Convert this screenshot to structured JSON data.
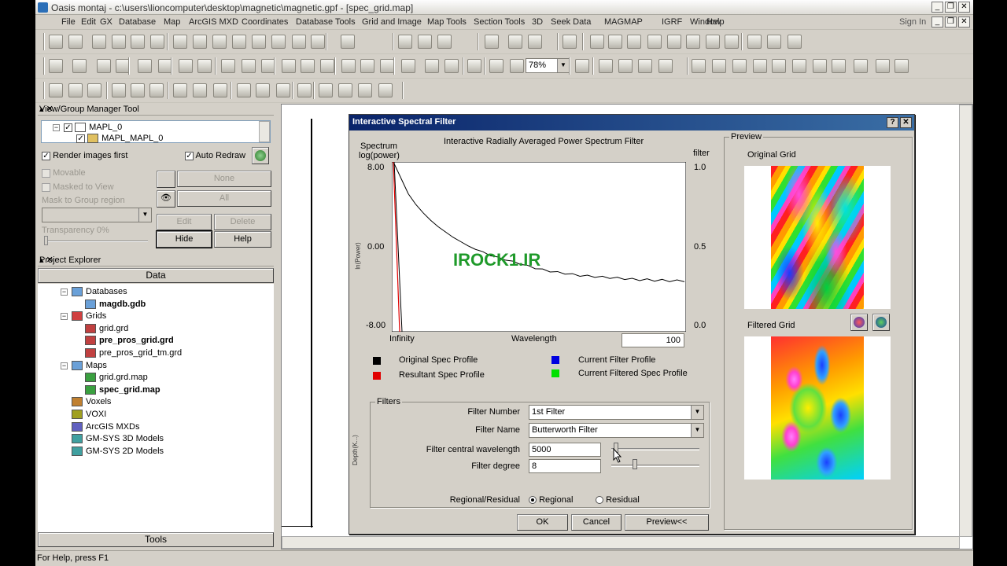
{
  "window": {
    "title": "Oasis montaj - c:\\users\\lioncomputer\\desktop\\magnetic\\magnetic.gpf - [spec_grid.map]"
  },
  "menu": [
    "File",
    "Edit",
    "GX",
    "Database",
    "Map",
    "ArcGIS MXD",
    "Coordinates",
    "Database Tools",
    "Grid and Image",
    "Map Tools",
    "Section Tools",
    "3D",
    "Seek Data",
    "MAGMAP",
    "IGRF",
    "Window",
    "Help"
  ],
  "sign_in": "Sign In",
  "toolbar": {
    "zoom_value": "78%"
  },
  "view_manager": {
    "title": "View/Group Manager Tool",
    "tree": [
      "MAPL_0",
      "MAPL_MAPL_0"
    ],
    "render_images_first": "Render images first",
    "auto_redraw": "Auto Redraw",
    "movable": "Movable",
    "masked_to_view": "Masked to View",
    "mask_to_group_region": "Mask to Group region",
    "none_btn": "None",
    "all_btn": "All",
    "edit_btn": "Edit",
    "delete_btn": "Delete",
    "transparency": "Transparency 0%",
    "hide_btn": "Hide",
    "help_btn": "Help"
  },
  "project_explorer": {
    "title": "Project Explorer",
    "tab": "Data",
    "items": [
      "Databases",
      "magdb.gdb",
      "Grids",
      "grid.grd",
      "pre_pros_grid.grd",
      "pre_pros_grid_tm.grd",
      "Maps",
      "grid.grd.map",
      "spec_grid.map",
      "Voxels",
      "VOXI",
      "ArcGIS MXDs",
      "GM-SYS 3D Models",
      "GM-SYS 2D Models"
    ],
    "tools_tab": "Tools"
  },
  "status": {
    "help": "For Help, press F1"
  },
  "dialog": {
    "title": "Interactive Spectral Filter",
    "help_btn": "?",
    "close_btn": "✕",
    "chart_title": "Interactive Radially Averaged Power Spectrum Filter",
    "y_label_1": "Spectrum",
    "y_label_2": "log(power)",
    "filter_label": "filter",
    "side_label_1": "ln(Power)",
    "side_label_2": "Depth(K...)",
    "x_left": "Infinity",
    "x_center": "Wavelength",
    "wavelength_value": "100",
    "watermark": "IROCK1.IR",
    "legend": [
      {
        "label": "Original Spec Profile",
        "color": "#000000"
      },
      {
        "label": "Resultant Spec Profile",
        "color": "#e00000"
      },
      {
        "label": "Current Filter Profile",
        "color": "#0000e0"
      },
      {
        "label": "Current Filtered Spec Profile",
        "color": "#00e000"
      }
    ],
    "filters": {
      "group_title": "Filters",
      "filter_number_label": "Filter Number",
      "filter_number_value": "1st Filter",
      "filter_name_label": "Filter Name",
      "filter_name_value": "Butterworth Filter",
      "central_wavelength_label": "Filter central wavelength",
      "central_wavelength_value": "5000",
      "degree_label": "Filter degree",
      "degree_value": "8",
      "mode_label": "Regional/Residual",
      "regional": "Regional",
      "residual": "Residual",
      "selected_mode": "Regional",
      "central_wavelength_slider": 0.03,
      "degree_slider": 0.25
    },
    "ok_btn": "OK",
    "cancel_btn": "Cancel",
    "preview_btn": "Preview<<",
    "preview": {
      "group_title": "Preview",
      "original_label": "Original Grid",
      "filtered_label": "Filtered Grid"
    }
  },
  "chart_data": {
    "type": "line",
    "title": "Interactive Radially Averaged Power Spectrum Filter",
    "y_left_ticks": [
      "8.00",
      "0.00",
      "-8.00"
    ],
    "y_right_ticks": [
      "1.0",
      "0.5",
      "0.0"
    ],
    "ylim_left": [
      -8,
      8
    ],
    "ylim_right": [
      0,
      1
    ],
    "series": [
      {
        "name": "Original Spec Profile",
        "color": "#000000",
        "values": [
          8.0,
          6.5,
          5.0,
          4.0,
          3.2,
          2.5,
          1.9,
          1.4,
          0.9,
          0.5,
          0.1,
          -0.2,
          -0.5,
          -0.8,
          -1.0,
          -1.2,
          -1.4,
          -1.6,
          -1.8,
          -2.0,
          -2.15,
          -2.3,
          -2.4,
          -2.5,
          -2.6,
          -2.7,
          -2.75,
          -2.8,
          -2.85,
          -2.9,
          -2.95,
          -3.0,
          -3.05,
          -3.1,
          -3.1,
          -3.15,
          -3.15,
          -3.2,
          -3.2,
          -3.2
        ]
      },
      {
        "name": "Resultant Spec Profile",
        "color": "#e00000",
        "values": [
          8.0,
          -8.0
        ]
      }
    ]
  }
}
